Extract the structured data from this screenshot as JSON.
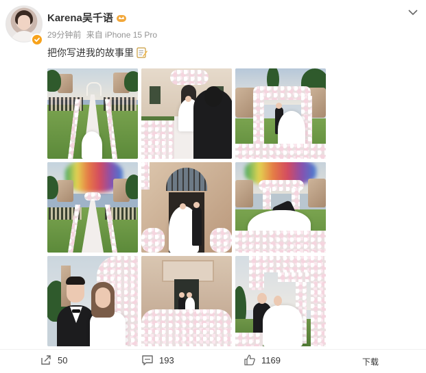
{
  "post": {
    "username": "Karena吴千语",
    "time": "29分钟前",
    "source": "来自 iPhone 15 Pro",
    "text": "把你写进我的故事里"
  },
  "photos": [
    {
      "name": "photo-ceremony-aisle"
    },
    {
      "name": "photo-bride-villa-entrance"
    },
    {
      "name": "photo-flower-arch-couple"
    },
    {
      "name": "photo-rainbow-smoke-aisle"
    },
    {
      "name": "photo-couple-doorway"
    },
    {
      "name": "photo-rainbow-kiss"
    },
    {
      "name": "photo-couple-portrait-closeup"
    },
    {
      "name": "photo-couple-balcony"
    },
    {
      "name": "photo-couple-flower-tunnel"
    }
  ],
  "actions": {
    "repost_count": "50",
    "comment_count": "193",
    "like_count": "1169",
    "download_label": "下载"
  },
  "colors": {
    "badge": "#f7a21b",
    "crown": "#f2a83b",
    "meta_text": "#939393"
  }
}
